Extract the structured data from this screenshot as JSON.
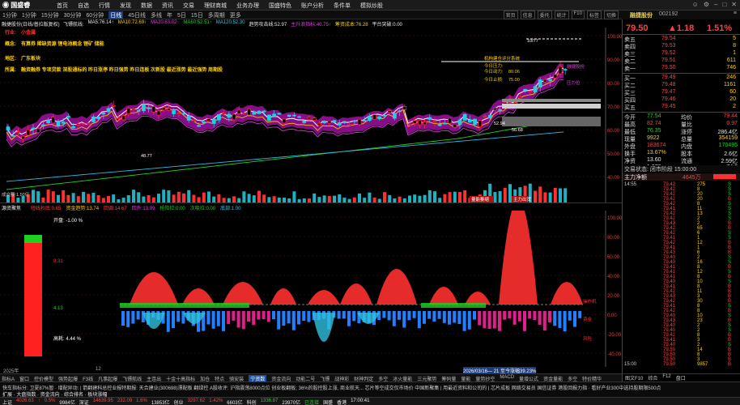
{
  "app": {
    "logo": "国盛睿",
    "menus": [
      "首页",
      "自选",
      "行情",
      "发现",
      "数据",
      "资讯",
      "交易",
      "理财商城",
      "业务办理",
      "国盛特色",
      "账户分析",
      "条件单",
      "模拟炒股"
    ]
  },
  "periods": [
    "1分钟",
    "1分钟",
    "15分钟",
    "30分钟",
    "60分钟",
    "日线",
    "45日线",
    "多线",
    "年",
    "5日",
    "15日",
    "多周期",
    "更多"
  ],
  "period_active_index": 5,
  "toolbar_right": [
    "官页",
    "信息",
    "委托",
    "统计",
    "F10",
    "标签",
    "切换"
  ],
  "stock": {
    "name": "融捷股份",
    "code": "002192"
  },
  "chart_header": {
    "title": "融捷股份(日线/普拉版复权)",
    "items": [
      {
        "t": "飞镖航线:",
        "c": "wt"
      },
      {
        "t": "MA5:76.14↑",
        "c": "wt"
      },
      {
        "t": "MA10:72.69↑",
        "c": "yl"
      },
      {
        "t": "MA20:63.02↑",
        "c": "mg"
      },
      {
        "t": "MA60:52.51↑",
        "c": "dn"
      },
      {
        "t": "MA120:52.30",
        "c": "cy"
      },
      {
        "t": "趋势攻击线:52.97",
        "c": "wt"
      },
      {
        "t": "主升浪指标:40.75↑",
        "c": "mg"
      },
      {
        "t": "筹资成本:76.28",
        "c": "yl"
      },
      {
        "t": "平台突破:0.00",
        "c": "wt"
      }
    ]
  },
  "annotations": [
    {
      "label": "行业:",
      "text": "小金属",
      "color": "#ff3030"
    },
    {
      "label": "概念:",
      "text": "有算券 稀缺资源 锂电池概念 锂矿 储能",
      "color": "#ffd000"
    },
    {
      "label": "地区:",
      "text": "广东板块",
      "color": "#ffd000"
    },
    {
      "label": "所属:",
      "text": "融资融券 专项贷款 深股通标的 昨日涨停 昨日强势 昨日连板 次新股 最近涨势 最近强势 周期股",
      "color": "#ffd000"
    }
  ],
  "overlay_labels": {
    "close_label": "融捷股份",
    "gain_label": "今日动力:",
    "stop_label": "今日止损:",
    "pressure": "今日压力:",
    "breakout": "机构建仓评分系统",
    "sell": "主力出货",
    "resist": "压力位",
    "vol_note": "量能萎缩",
    "low_mark": "48.77",
    "mark1": "56.68",
    "mark2": "80.06",
    "mark3": "75.00",
    "h1": "10/77",
    "h2": "52.94"
  },
  "price_axis": [
    "100.00",
    "90.00",
    "80.00",
    "70.00",
    "60.00",
    "50.00",
    "40.00"
  ],
  "vol_axis_left": "成交额:1.50亿",
  "sub_header": {
    "title": "源资聚焦",
    "items": [
      {
        "t": "短线抄底:0.65",
        "c": "up"
      },
      {
        "t": "资金趋势:13.74",
        "c": "yl"
      },
      {
        "t": "回调:14.67",
        "c": "up"
      },
      {
        "t": "回升:13.99",
        "c": "mg"
      },
      {
        "t": "抢险拉:0.00",
        "c": "dn"
      },
      {
        "t": "次吸拉:0.00",
        "c": "dn"
      },
      {
        "t": "底部:1.00",
        "c": "cy"
      }
    ]
  },
  "sub_left": {
    "open": "开盘: -1.00 %",
    "lvl1": "8.31",
    "lvl2": "4.13",
    "lvl3": "高耗: 4.44 %"
  },
  "sub_right_labels": {
    "a": "操作机",
    "b": "资金",
    "c": "风险"
  },
  "sub_axis": [
    "100.00",
    "80.00",
    "60.00",
    "40.00",
    "20.00",
    "0.00",
    "-20.00",
    "-40.00"
  ],
  "date_axis": {
    "left": "2025年",
    "mid": "12",
    "note": "2026/03/16— 21 至今涨幅39.23%"
  },
  "tabs": [
    "指标A",
    "窗口",
    "控价模型",
    "强势起爆",
    "F3线",
    "凡事起爆",
    "飞镖航线",
    "主连出",
    "十金十高指标",
    "加仓",
    "特点",
    "骑安装",
    "宁资数",
    "资金流向",
    "动能二号",
    "飞镖",
    "战神彩",
    "财神判定",
    "多空",
    "冰火量能",
    "三元聚势",
    "筹码量",
    "量能",
    "量势抄空",
    "MACD",
    "量增公式",
    "资金量能",
    "多空",
    "特价精华"
  ],
  "tab_active_index": 12,
  "quote": {
    "price": "79.50",
    "change": "▲1.18",
    "pct": "1.51%",
    "sells": [
      {
        "l": "卖五",
        "p": "79.54",
        "v": "5"
      },
      {
        "l": "卖四",
        "p": "79.53",
        "v": "8"
      },
      {
        "l": "卖三",
        "p": "79.52",
        "v": "1"
      },
      {
        "l": "卖二",
        "p": "79.51",
        "v": "611"
      },
      {
        "l": "卖一",
        "p": "79.50",
        "v": "746"
      }
    ],
    "buys": [
      {
        "l": "买一",
        "p": "79.49",
        "v": "246"
      },
      {
        "l": "买二",
        "p": "79.48",
        "v": "1161"
      },
      {
        "l": "买三",
        "p": "79.47",
        "v": "60"
      },
      {
        "l": "买四",
        "p": "79.46",
        "v": "20"
      },
      {
        "l": "买五",
        "p": "79.45",
        "v": "2"
      }
    ],
    "stats": [
      {
        "a": "今开",
        "av": "77.54",
        "ac": "dn",
        "b": "均价",
        "bv": "79.44",
        "bc": "up"
      },
      {
        "a": "最高",
        "av": "82.74",
        "ac": "up",
        "b": "量比",
        "bv": "0.97",
        "bc": "up"
      },
      {
        "a": "最低",
        "av": "76.35",
        "ac": "dn",
        "b": "涨停",
        "bv": "286.4亿",
        "bc": "wt"
      },
      {
        "a": "现量",
        "av": "9922",
        "ac": "yl",
        "b": "总量",
        "bv": "354159",
        "bc": "yl"
      },
      {
        "a": "外盘",
        "av": "183674",
        "ac": "up",
        "b": "内盘",
        "bv": "170495",
        "bc": "dn"
      },
      {
        "a": "换手",
        "av": "13.67%",
        "ac": "yl",
        "b": "股本",
        "bv": "2.6亿",
        "bc": "wt"
      },
      {
        "a": "净资",
        "av": "13.60",
        "ac": "wt",
        "b": "流通",
        "bv": "2.59亿",
        "bc": "wt"
      },
      {
        "a": "收益(四)",
        "av": "1.070",
        "ac": "wt",
        "b": "PE(动)",
        "bv": "74.3",
        "bc": "wt"
      }
    ],
    "trade_status": "交易状态: 闭市阶段 15:00:00",
    "main_flow_label": "主力净额",
    "main_flow_val": "4645万",
    "ticks": [
      [
        "14:55",
        "79.42",
        "275",
        "S"
      ],
      [
        "",
        "79.42",
        "8",
        "S"
      ],
      [
        "",
        "79.42",
        "20",
        "S"
      ],
      [
        "",
        "79.42",
        "20",
        "B"
      ],
      [
        "",
        "79.42",
        "8",
        "S"
      ],
      [
        "",
        "79.41",
        "11",
        "S"
      ],
      [
        "",
        "79.42",
        "13",
        "S"
      ],
      [
        "",
        "79.42",
        "2",
        "S"
      ],
      [
        "",
        "79.43",
        "2",
        "B"
      ],
      [
        "",
        "79.42",
        "65",
        "B"
      ],
      [
        "",
        "79.42",
        "6",
        "S"
      ],
      [
        "",
        "79.41",
        "1",
        "S"
      ],
      [
        "",
        "79.42",
        "12",
        "B"
      ],
      [
        "",
        "79.41",
        "1",
        "B"
      ],
      [
        "",
        "79.43",
        "6",
        "B"
      ],
      [
        "",
        "79.40",
        "2",
        "S"
      ],
      [
        "",
        "79.40",
        "16",
        "S"
      ],
      [
        "",
        "79.41",
        "8",
        "B"
      ],
      [
        "",
        "79.41",
        "12",
        "S"
      ],
      [
        "",
        "79.41",
        "8",
        "B"
      ],
      [
        "",
        "79.40",
        "10",
        "S"
      ],
      [
        "",
        "79.41",
        "8",
        "B"
      ],
      [
        "",
        "79.42",
        "11",
        "B"
      ],
      [
        "",
        "79.43",
        "3",
        "B"
      ],
      [
        "",
        "79.42",
        "30",
        "B"
      ],
      [
        "",
        "79.41",
        "8",
        "S"
      ],
      [
        "",
        "79.42",
        "8",
        "B"
      ],
      [
        "",
        "79.40",
        "10",
        "S"
      ],
      [
        "",
        "79.43",
        "23",
        "B"
      ],
      [
        "",
        "79.40",
        "2",
        "S"
      ],
      [
        "",
        "79.40",
        "2",
        "S"
      ],
      [
        "",
        "79.42",
        "8",
        "B"
      ],
      [
        "",
        "79.41",
        "3",
        "B"
      ],
      [
        "",
        "79.40",
        "2",
        "S"
      ],
      [
        "",
        "79.50",
        "14",
        "B"
      ],
      [
        "",
        "79.50",
        "8",
        "B"
      ],
      [
        "",
        "79.50",
        "3",
        "B"
      ],
      [
        "15:00",
        "79.50",
        "9857",
        "B"
      ]
    ],
    "bottom_tabs": [
      "图文F10",
      "综合",
      "F12",
      "盘口"
    ]
  },
  "news": "快车指标分: 卫夏87%暂   · 增配异动:  |  箭翻建科总控业报特期报: 天合建业(300698)漂配板 翻绿控  A股收评: 沪指震荡8000点位  创业板翻板; 36%的股控股上涨, 商业航天...  芯片等空成交仅市场价 中国新聚集  |  用最近资料和公司的  |  芯片成板 网络交易员  国信证券 港股回报力指 · 看好产业300中选持股期限500点",
  "news2": [
    {
      "t": "扩展 ·  大盘指数  ·  资金流向  ·  综合排名  ·  板块涨幅",
      "c": "wt"
    }
  ],
  "statusbar": [
    {
      "t": "上证",
      "c": "wt"
    },
    {
      "t": "4026.63",
      "c": "up"
    },
    {
      "t": "↑",
      "c": "up"
    },
    {
      "t": "0.5%",
      "c": "up"
    },
    {
      "t": "9984亿",
      "c": "wt"
    },
    {
      "t": "深证",
      "c": "wt"
    },
    {
      "t": "14639.95",
      "c": "up"
    },
    {
      "t": "232.09",
      "c": "up"
    },
    {
      "t": "1.6%",
      "c": "up"
    },
    {
      "t": "13853亿",
      "c": "wt"
    },
    {
      "t": "创业",
      "c": "wt"
    },
    {
      "t": "3297.62",
      "c": "up"
    },
    {
      "t": "1.42%",
      "c": "up"
    },
    {
      "t": "6603亿",
      "c": "wt"
    },
    {
      "t": "科创",
      "c": "wt"
    },
    {
      "t": "1336.87",
      "c": "dn"
    },
    {
      "t": "23970亿",
      "c": "wt"
    },
    {
      "t": "已连接",
      "c": "dn"
    },
    {
      "t": "国盛",
      "c": "wt"
    },
    {
      "t": "香港",
      "c": "wt"
    },
    {
      "t": "17:00:41",
      "c": "wt"
    }
  ],
  "colors": {
    "up": "#ff3030",
    "down": "#20d020",
    "ma5": "#ffffff",
    "ma10": "#ffd000",
    "ma20": "#e040e0",
    "ma60": "#20d020",
    "ma120": "#30b8e0"
  }
}
